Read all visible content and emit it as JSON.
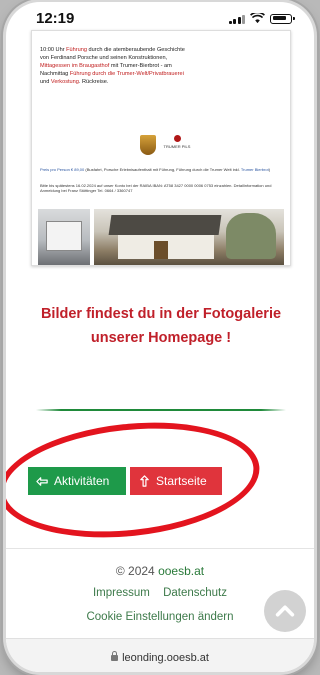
{
  "status_bar": {
    "time": "12:19"
  },
  "document": {
    "line1_a": "10:00 Uhr ",
    "line1_b": "Führung",
    "line1_c": " durch die atemberaubende Geschichte",
    "line2": "von Ferdinand Porsche und seinen Konstruktionen,",
    "line3_a": "Mittagessen im Braugasthof",
    "line3_b": " mit Trumer-Bierbrot - am",
    "line4_a": "Nachmittag ",
    "line4_b": "Führung durch die Trumer-Welt/Privatbrauerei",
    "line5_a": "und ",
    "line5_b": "Verkostung",
    "line5_c": ". Rückreise.",
    "logo_text": "TRUMER PILS",
    "price_a": "Preis pro Person € 89,00",
    "price_b": " (Busfahrt, Porsche Erlebnisaufenthalt mit Führung, Führung durch die Trumer Welt inkl. ",
    "price_c": "Trumer Bierbrot",
    "price_d": ")",
    "bank_text": "Bitte bis spätestens 16.02.2024 auf unser Konto bei der RAIBA IBAN: AT58 3427 0000 0006 0753 einzahlen. Detailinformation und Anmeldung bei Franz Stöttinger Tel. 0664 / 3360747"
  },
  "gallery_text": "Bilder findest du in der Fotogalerie unserer Homepage !",
  "buttons": {
    "activities": "Aktivitäten",
    "home": "Startseite"
  },
  "footer": {
    "copyright_prefix": "© 2024 ",
    "copyright_link": "ooesb.at",
    "impressum": "Impressum",
    "datenschutz": "Datenschutz",
    "cookie": "Cookie Einstellungen ändern"
  },
  "browser": {
    "url": "leonding.ooesb.at"
  },
  "colors": {
    "accent_red": "#c0202a",
    "button_green": "#1e9a4a",
    "button_red": "#e0343c",
    "annotation_red": "#e3141e"
  },
  "icons": {
    "activities": "hand-pointing-icon",
    "home": "hand-pointing-icon",
    "scroll": "chevron-up-icon"
  }
}
